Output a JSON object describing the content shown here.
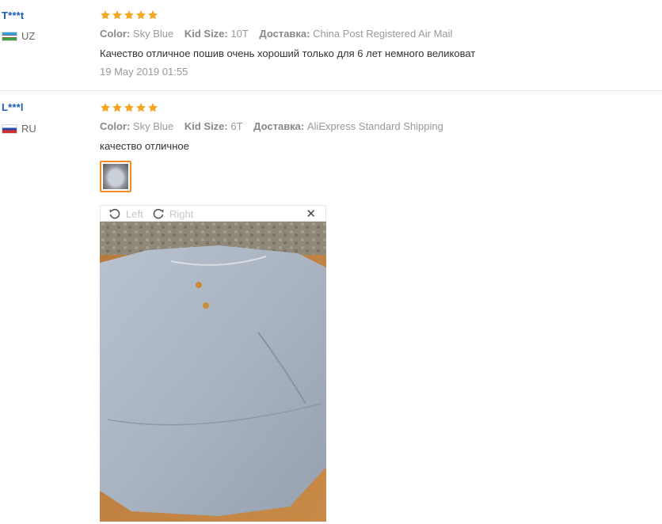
{
  "colors": {
    "accent_orange": "#f08a24",
    "user_blue": "#1a5fb4",
    "star_orange": "#f5a623"
  },
  "reviews": [
    {
      "user": "T***t",
      "country_code": "UZ",
      "flag_icon": "uzbekistan-flag-icon",
      "rating": 5,
      "color_label": "Color:",
      "color_value": "Sky Blue",
      "size_label": "Kid Size:",
      "size_value": "10T",
      "shipping_label": "Доставка:",
      "shipping_value": "China Post Registered Air Mail",
      "text": "Качество отличное пошив очень хороший только для 6 лет немного великоват",
      "date": "19 May 2019 01:55"
    },
    {
      "user": "L***l",
      "country_code": "RU",
      "flag_icon": "russia-flag-icon",
      "rating": 5,
      "color_label": "Color:",
      "color_value": "Sky Blue",
      "size_label": "Kid Size:",
      "size_value": "6T",
      "shipping_label": "Доставка:",
      "shipping_value": "AliExpress Standard Shipping",
      "text": "качество отличное",
      "photo_viewer": {
        "rotate_left_label": "Left",
        "rotate_right_label": "Right",
        "close_label": "✕"
      }
    }
  ]
}
